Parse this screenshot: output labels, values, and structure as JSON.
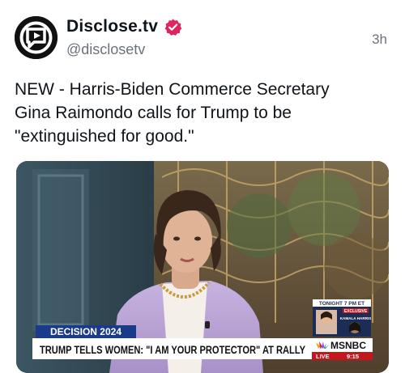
{
  "post": {
    "author_name": "Disclose.tv",
    "handle": "@disclosetv",
    "timestamp": "3h",
    "text_lines": [
      "NEW - Harris-Biden Commerce Secretary",
      "Gina Raimondo calls for Trump to be",
      "\"extinguished for good.\""
    ]
  },
  "icons": {
    "avatar": "disclose-logo-icon",
    "verified": "verified-badge-icon"
  },
  "colors": {
    "verified_badge": "#e0245e",
    "lower_third_red": "#c4161c",
    "decision_blue": "#1a3a8a"
  },
  "media": {
    "decision_label": "DECISION 2024",
    "headline": "TRUMP TELLS WOMEN: \"I AM YOUR PROTECTOR\" AT RALLY",
    "network": "MSNBC",
    "live_label": "LIVE",
    "live_time": "9:15",
    "promo_time": "TONIGHT 7 PM ET",
    "promo_exclusive": "EXCLUSIVE",
    "promo_title": "KAMALA HARRIS"
  }
}
